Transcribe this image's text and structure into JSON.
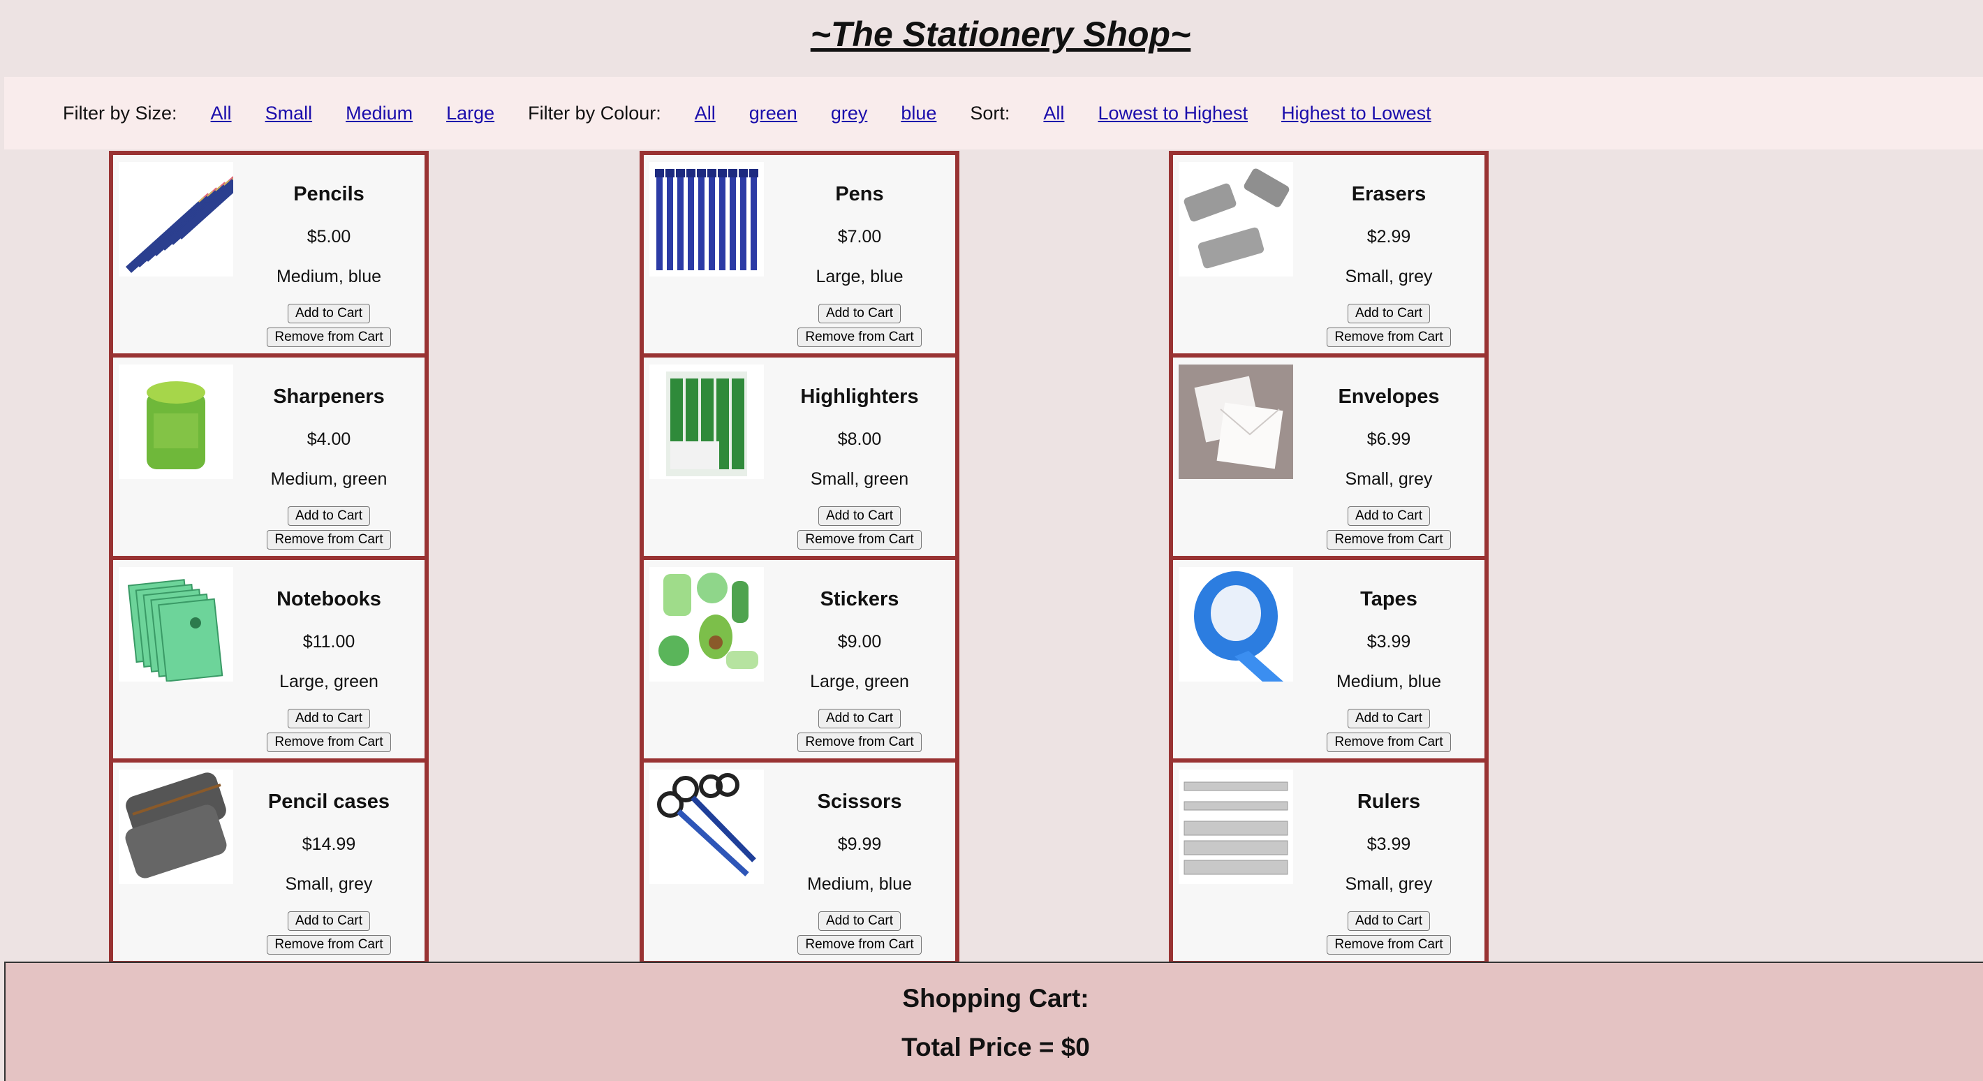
{
  "header": {
    "title": "~The Stationery Shop~"
  },
  "filters": {
    "size_label": "Filter by Size:",
    "size_options": [
      "All",
      "Small",
      "Medium",
      "Large"
    ],
    "colour_label": "Filter by Colour:",
    "colour_options": [
      "All",
      "green",
      "grey",
      "blue"
    ],
    "sort_label": "Sort:",
    "sort_options": [
      "All",
      "Lowest to Highest",
      "Highest to Lowest"
    ]
  },
  "buttons": {
    "add": "Add to Cart",
    "remove": "Remove from Cart"
  },
  "products": [
    [
      {
        "name": "Pencils",
        "price": "$5.00",
        "desc": "Medium, blue",
        "icon": "pencils-image"
      },
      {
        "name": "Sharpeners",
        "price": "$4.00",
        "desc": "Medium, green",
        "icon": "sharpener-image"
      },
      {
        "name": "Notebooks",
        "price": "$11.00",
        "desc": "Large, green",
        "icon": "notebooks-image"
      },
      {
        "name": "Pencil cases",
        "price": "$14.99",
        "desc": "Small, grey",
        "icon": "pencil-cases-image"
      }
    ],
    [
      {
        "name": "Pens",
        "price": "$7.00",
        "desc": "Large, blue",
        "icon": "pens-image"
      },
      {
        "name": "Highlighters",
        "price": "$8.00",
        "desc": "Small, green",
        "icon": "highlighters-image"
      },
      {
        "name": "Stickers",
        "price": "$9.00",
        "desc": "Large, green",
        "icon": "stickers-image"
      },
      {
        "name": "Scissors",
        "price": "$9.99",
        "desc": "Medium, blue",
        "icon": "scissors-image"
      }
    ],
    [
      {
        "name": "Erasers",
        "price": "$2.99",
        "desc": "Small, grey",
        "icon": "erasers-image"
      },
      {
        "name": "Envelopes",
        "price": "$6.99",
        "desc": "Small, grey",
        "icon": "envelopes-image"
      },
      {
        "name": "Tapes",
        "price": "$3.99",
        "desc": "Medium, blue",
        "icon": "tape-image"
      },
      {
        "name": "Rulers",
        "price": "$3.99",
        "desc": "Small, grey",
        "icon": "rulers-image"
      }
    ]
  ],
  "cart": {
    "heading": "Shopping Cart:",
    "total": "Total Price = $0"
  },
  "colors": {
    "background": "#ede3e3",
    "card_border": "#993333",
    "cart_bg": "#e4c3c3",
    "link": "#1a0dab"
  }
}
